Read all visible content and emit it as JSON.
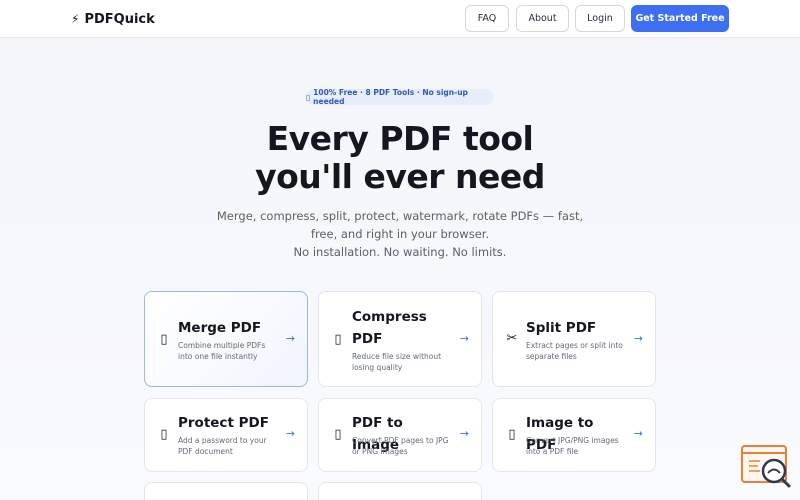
{
  "nav": {
    "logo_icon": "⚡",
    "logo_text": "PDFQuick",
    "faq": "FAQ",
    "about": "About",
    "login": "Login",
    "cta": "Get Started Free"
  },
  "hero": {
    "badge_icon": "▯",
    "badge_text": "100% Free · 8 PDF Tools · No sign-up needed",
    "title_line1": "Every PDF tool",
    "title_line2": "you'll ever need",
    "sub_line1": "Merge, compress, split, protect, watermark, rotate PDFs — fast,",
    "sub_line2": "free, and right in your browser.",
    "sub_line3": "No installation. No waiting. No limits."
  },
  "tools": [
    {
      "icon": "▯",
      "title": "Merge PDF",
      "desc": "Combine multiple PDFs into one file instantly"
    },
    {
      "icon": "▯",
      "title": "Compress PDF",
      "desc": "Reduce file size without losing quality"
    },
    {
      "icon": "✂",
      "title": "Split PDF",
      "desc": "Extract pages or split into separate files"
    },
    {
      "icon": "▯",
      "title": "Protect PDF",
      "desc": "Add a password to your PDF document"
    },
    {
      "icon": "▯",
      "title": "PDF to Image",
      "desc": "Convert PDF pages to JPG or PNG images"
    },
    {
      "icon": "▯",
      "title": "Image to PDF",
      "desc": "Convert JPG/PNG images into a PDF file"
    }
  ],
  "arrow": "→",
  "colors": {
    "accent": "#3d6ff0",
    "widget": "#e8803a"
  }
}
